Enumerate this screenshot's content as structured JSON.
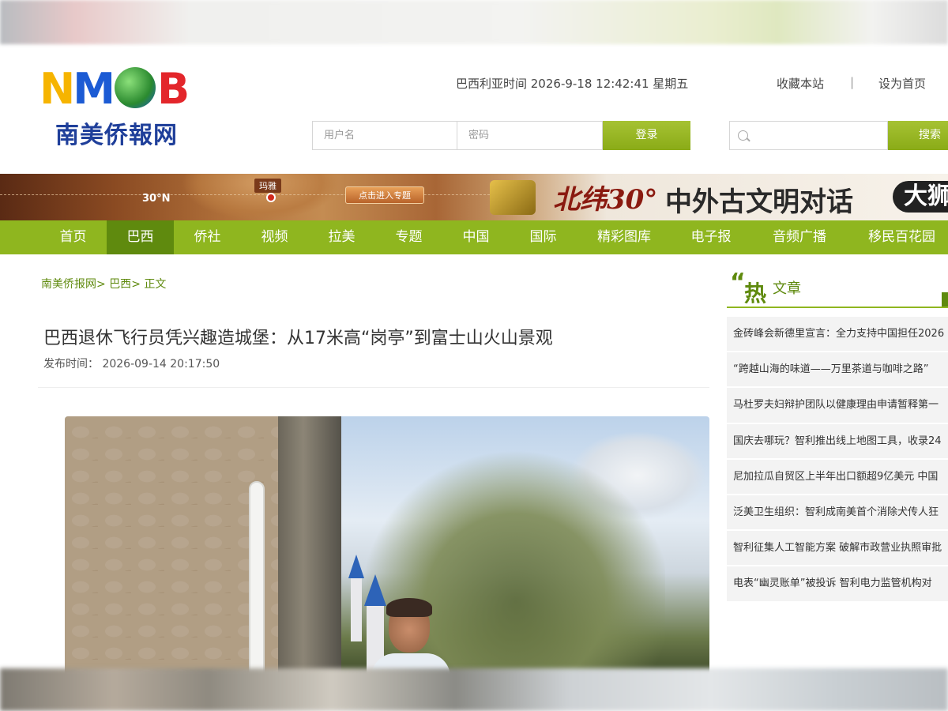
{
  "header": {
    "logo_mark": "NMOB",
    "logo_subtitle": "南美侨報网",
    "datetime": "巴西利亚时间 2026-9-18 12:42:41 星期五",
    "favorite_link": "收藏本站",
    "separator": "|",
    "homepage_link": "设为首页"
  },
  "login": {
    "username_placeholder": "用户名",
    "password_placeholder": "密码",
    "login_button": "登录"
  },
  "search": {
    "placeholder": "",
    "button": "搜索"
  },
  "banner": {
    "latitude_label": "30°N",
    "maya_label": "玛雅",
    "topic_button": "点击进入专题",
    "calligraphy": "北纬30°",
    "title": "中外古文明对话",
    "end_text": "大狮"
  },
  "nav": {
    "items": [
      {
        "label": "首页",
        "active": false
      },
      {
        "label": "巴西",
        "active": true
      },
      {
        "label": "侨社",
        "active": false
      },
      {
        "label": "视频",
        "active": false
      },
      {
        "label": "拉美",
        "active": false
      },
      {
        "label": "专题",
        "active": false
      },
      {
        "label": "中国",
        "active": false
      },
      {
        "label": "国际",
        "active": false
      },
      {
        "label": "精彩图库",
        "active": false
      },
      {
        "label": "电子报",
        "active": false
      },
      {
        "label": "音频广播",
        "active": false
      },
      {
        "label": "移民百花园",
        "active": false
      }
    ]
  },
  "breadcrumb": {
    "items": [
      "南美侨报网",
      "巴西",
      "正文"
    ],
    "separator": ">"
  },
  "article": {
    "title": "巴西退休飞行员凭兴趣造城堡：从17米高“岗亭”到富士山火山景观",
    "publish_label": "发布时间：",
    "publish_time": "2026-09-14 20:17:50"
  },
  "sidebar": {
    "hot_quote": "“",
    "hot_big": "热",
    "hot_small": "文章",
    "items": [
      "金砖峰会新德里宣言：全力支持中国担任2026",
      "“跨越山海的味道——万里茶道与咖啡之路”",
      "马杜罗夫妇辩护团队以健康理由申请暂释第一",
      "国庆去哪玩？智利推出线上地图工具，收录24",
      "尼加拉瓜自贸区上半年出口额超9亿美元 中国",
      "泛美卫生组织：智利成南美首个消除犬传人狂",
      "智利征集人工智能方案 破解市政营业执照审批",
      "电表“幽灵账单”被投诉 智利电力监管机构对"
    ]
  },
  "colors": {
    "accent_green": "#8fb61f",
    "active_green": "#5f8a0e"
  }
}
